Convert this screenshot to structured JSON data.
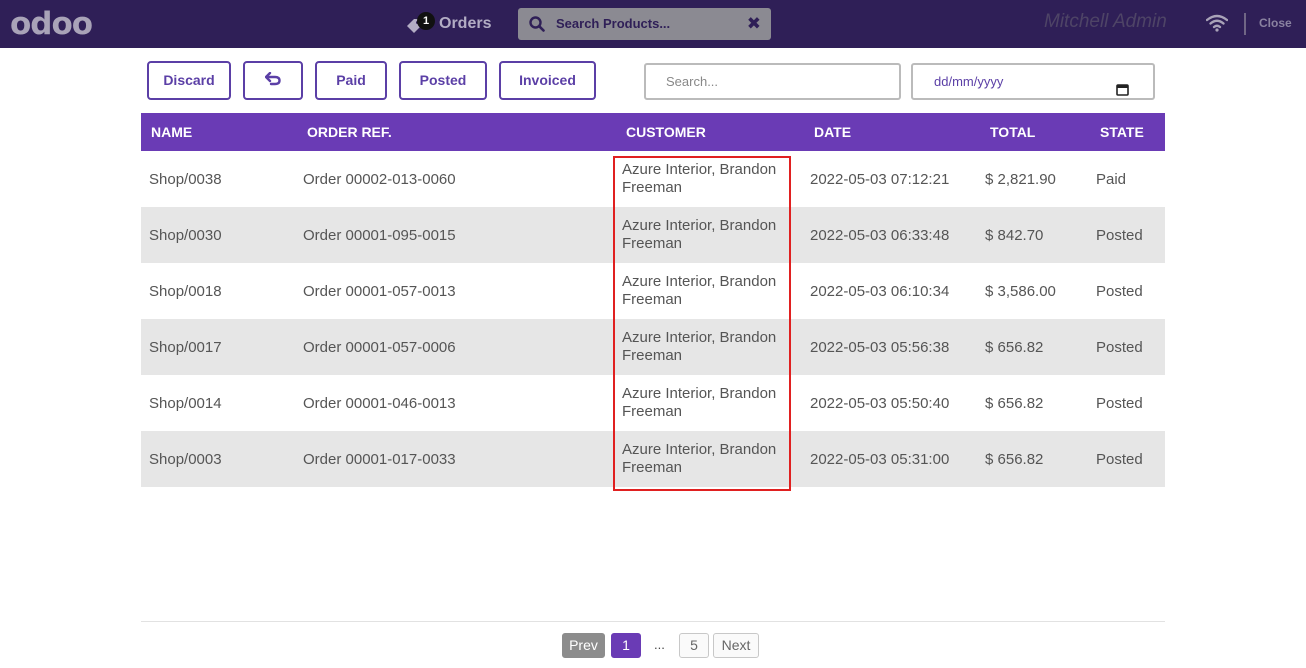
{
  "topbar": {
    "logo": "odoo",
    "orders_label": "Orders",
    "orders_badge": "1",
    "search_placeholder": "Search Products...",
    "clear_symbol": "✖",
    "user_name": "Mitchell Admin",
    "close_label": "Close"
  },
  "toolbar": {
    "discard_label": "Discard",
    "back_icon": "undo-arrow-icon",
    "paid_label": "Paid",
    "posted_label": "Posted",
    "invoiced_label": "Invoiced",
    "search_placeholder": "Search...",
    "date_placeholder": "dd/mm/yyyy"
  },
  "table": {
    "headers": {
      "name": "NAME",
      "order_ref": "ORDER REF.",
      "customer": "CUSTOMER",
      "date": "DATE",
      "total": "TOTAL",
      "state": "STATE"
    },
    "rows": [
      {
        "name": "Shop/0038",
        "order_ref": "Order 00002-013-0060",
        "customer": "Azure Interior, Brandon Freeman",
        "date": "2022-05-03 07:12:21",
        "total": "$ 2,821.90",
        "state": "Paid"
      },
      {
        "name": "Shop/0030",
        "order_ref": "Order 00001-095-0015",
        "customer": "Azure Interior, Brandon Freeman",
        "date": "2022-05-03 06:33:48",
        "total": "$ 842.70",
        "state": "Posted"
      },
      {
        "name": "Shop/0018",
        "order_ref": "Order 00001-057-0013",
        "customer": "Azure Interior, Brandon Freeman",
        "date": "2022-05-03 06:10:34",
        "total": "$ 3,586.00",
        "state": "Posted"
      },
      {
        "name": "Shop/0017",
        "order_ref": "Order 00001-057-0006",
        "customer": "Azure Interior, Brandon Freeman",
        "date": "2022-05-03 05:56:38",
        "total": "$ 656.82",
        "state": "Posted"
      },
      {
        "name": "Shop/0014",
        "order_ref": "Order 00001-046-0013",
        "customer": "Azure Interior, Brandon Freeman",
        "date": "2022-05-03 05:50:40",
        "total": "$ 656.82",
        "state": "Posted"
      },
      {
        "name": "Shop/0003",
        "order_ref": "Order 00001-017-0033",
        "customer": "Azure Interior, Brandon Freeman",
        "date": "2022-05-03 05:31:00",
        "total": "$ 656.82",
        "state": "Posted"
      }
    ]
  },
  "pager": {
    "prev_label": "Prev",
    "current_page": "1",
    "ellipsis": "...",
    "last_page": "5",
    "next_label": "Next"
  },
  "colors": {
    "topbar": "#2f1f57",
    "accent": "#6a3bb5",
    "highlight": "#e02020",
    "row_alt": "#e6e6e6"
  }
}
